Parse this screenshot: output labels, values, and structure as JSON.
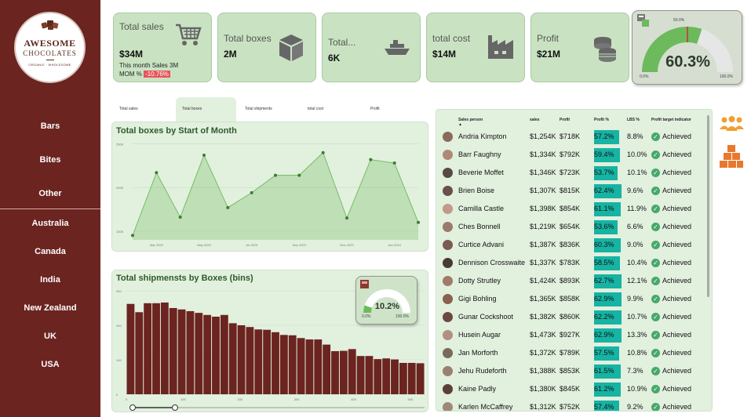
{
  "logo": {
    "brand_line1": "AWESOME",
    "brand_line2": "CHOCOLATES",
    "tagline": "ORGANIC · WHOLESOME"
  },
  "sidebar": {
    "products": [
      {
        "label": "Bars"
      },
      {
        "label": "Bites"
      },
      {
        "label": "Other"
      }
    ],
    "countries": [
      {
        "label": "Australia"
      },
      {
        "label": "Canada"
      },
      {
        "label": "India"
      },
      {
        "label": "New Zealand"
      },
      {
        "label": "UK"
      },
      {
        "label": "USA"
      }
    ]
  },
  "kpis": {
    "sales": {
      "title": "Total sales",
      "value": "$34M",
      "month_text": "This month Sales 3M",
      "mom_label": "MOM %",
      "mom_value": "-10.76%",
      "icon": "cart-icon"
    },
    "boxes": {
      "title": "Total boxes",
      "value": "2M",
      "icon": "box-icon"
    },
    "shipments": {
      "title": "Total...",
      "value": "6K",
      "icon": "ship-icon"
    },
    "cost": {
      "title": "total cost",
      "value": "$14M",
      "icon": "factory-icon"
    },
    "profit": {
      "title": "Profit",
      "value": "$21M",
      "icon": "coins-icon"
    }
  },
  "profit_gauge": {
    "value": 60.3,
    "value_text": "60.3%",
    "min_label": "0.0%",
    "max_label": "100.0%",
    "target_label": "50.0%",
    "target": 50,
    "fill_color": "#6cba5c",
    "track_color": "#e6e6e6",
    "target_color": "#c0392b"
  },
  "tabs": [
    {
      "label": "Total sales"
    },
    {
      "label": "Total boxes"
    },
    {
      "label": "Total shipments"
    },
    {
      "label": "total cost"
    },
    {
      "label": "Profit"
    }
  ],
  "active_tab": "Total boxes",
  "line_chart_data": {
    "type": "area",
    "title": "Total boxes by Start of Month",
    "y_tick_labels": [
      "150K",
      "200K",
      "250K"
    ],
    "x_tick_labels": [
      "Mar 2023",
      "May 2023",
      "Jul 2023",
      "Sep 2023",
      "Nov 2023",
      "Jan 2024"
    ],
    "values": [
      145,
      217,
      166,
      237,
      177,
      194,
      214,
      214,
      240,
      165,
      232,
      228,
      160
    ],
    "ylim": [
      140,
      255
    ],
    "color": "#6cba5c"
  },
  "bar_chart_data": {
    "type": "bar",
    "title": "Total shipmensts by Boxes (bins)",
    "y_tick_labels": [
      "0",
      "100",
      "200",
      "300"
    ],
    "x_tick_labels": [
      "0",
      "100",
      "200",
      "300",
      "400",
      "500"
    ],
    "values": [
      262,
      238,
      264,
      264,
      266,
      250,
      246,
      241,
      236,
      230,
      225,
      230,
      206,
      200,
      195,
      188,
      187,
      180,
      172,
      171,
      163,
      159,
      159,
      144,
      125,
      126,
      131,
      111,
      111,
      102,
      104,
      101,
      91,
      91,
      90
    ],
    "ylim": [
      0,
      300
    ],
    "xlim": [
      0,
      525
    ],
    "color": "#6b2420"
  },
  "mini_gauge": {
    "value": 10.2,
    "value_text": "10.2%",
    "min_label": "0.0%",
    "max_label": "100.0%",
    "fill_color": "#6cba5c"
  },
  "table": {
    "headers": {
      "person": "Sales person",
      "sales": "sales",
      "profit": "Profit",
      "profit_pct": "Profit %",
      "lbs": "LBS %",
      "indicator": "Profit target indicator"
    },
    "rows": [
      {
        "name": "Andria Kimpton",
        "sales": "$1,254K",
        "profit": "$718K",
        "profit_pct": "57.2%",
        "pct": 57.2,
        "lbs": "8.8%",
        "status": "Achieved"
      },
      {
        "name": "Barr Faughny",
        "sales": "$1,334K",
        "profit": "$792K",
        "profit_pct": "59.4%",
        "pct": 59.4,
        "lbs": "10.0%",
        "status": "Achieved"
      },
      {
        "name": "Beverie Moffet",
        "sales": "$1,346K",
        "profit": "$723K",
        "profit_pct": "53.7%",
        "pct": 53.7,
        "lbs": "10.1%",
        "status": "Achieved"
      },
      {
        "name": "Brien Boise",
        "sales": "$1,307K",
        "profit": "$815K",
        "profit_pct": "62.4%",
        "pct": 62.4,
        "lbs": "9.6%",
        "status": "Achieved"
      },
      {
        "name": "Camilla Castle",
        "sales": "$1,398K",
        "profit": "$854K",
        "profit_pct": "61.1%",
        "pct": 61.1,
        "lbs": "11.9%",
        "status": "Achieved"
      },
      {
        "name": "Ches Bonnell",
        "sales": "$1,219K",
        "profit": "$654K",
        "profit_pct": "53.6%",
        "pct": 53.6,
        "lbs": "6.6%",
        "status": "Achieved"
      },
      {
        "name": "Curtice Advani",
        "sales": "$1,387K",
        "profit": "$836K",
        "profit_pct": "60.3%",
        "pct": 60.3,
        "lbs": "9.0%",
        "status": "Achieved"
      },
      {
        "name": "Dennison Crosswaite",
        "sales": "$1,337K",
        "profit": "$783K",
        "profit_pct": "58.5%",
        "pct": 58.5,
        "lbs": "10.4%",
        "status": "Achieved"
      },
      {
        "name": "Dotty Strutley",
        "sales": "$1,424K",
        "profit": "$893K",
        "profit_pct": "62.7%",
        "pct": 62.7,
        "lbs": "12.1%",
        "status": "Achieved"
      },
      {
        "name": "Gigi Bohling",
        "sales": "$1,365K",
        "profit": "$858K",
        "profit_pct": "62.9%",
        "pct": 62.9,
        "lbs": "9.9%",
        "status": "Achieved"
      },
      {
        "name": "Gunar Cockshoot",
        "sales": "$1,382K",
        "profit": "$860K",
        "profit_pct": "62.2%",
        "pct": 62.2,
        "lbs": "10.7%",
        "status": "Achieved"
      },
      {
        "name": "Husein Augar",
        "sales": "$1,473K",
        "profit": "$927K",
        "profit_pct": "62.9%",
        "pct": 62.9,
        "lbs": "13.3%",
        "status": "Achieved"
      },
      {
        "name": "Jan Morforth",
        "sales": "$1,372K",
        "profit": "$789K",
        "profit_pct": "57.5%",
        "pct": 57.5,
        "lbs": "10.8%",
        "status": "Achieved"
      },
      {
        "name": "Jehu Rudeforth",
        "sales": "$1,388K",
        "profit": "$853K",
        "profit_pct": "61.5%",
        "pct": 61.5,
        "lbs": "7.3%",
        "status": "Achieved"
      },
      {
        "name": "Kaine Padly",
        "sales": "$1,380K",
        "profit": "$845K",
        "profit_pct": "61.2%",
        "pct": 61.2,
        "lbs": "10.9%",
        "status": "Achieved"
      },
      {
        "name": "Karlen McCaffrey",
        "sales": "$1,312K",
        "profit": "$752K",
        "profit_pct": "57.4%",
        "pct": 57.4,
        "lbs": "9.2%",
        "status": "Achieved"
      }
    ]
  },
  "colors": {
    "sidebar": "#6b2420",
    "card": "#c9e3c2",
    "panel": "#e2f0de",
    "bar_fill": "#17b3a3",
    "icon_orange": "#f0a030"
  },
  "side_icons": [
    "people-icon",
    "boxes-stack-icon"
  ]
}
